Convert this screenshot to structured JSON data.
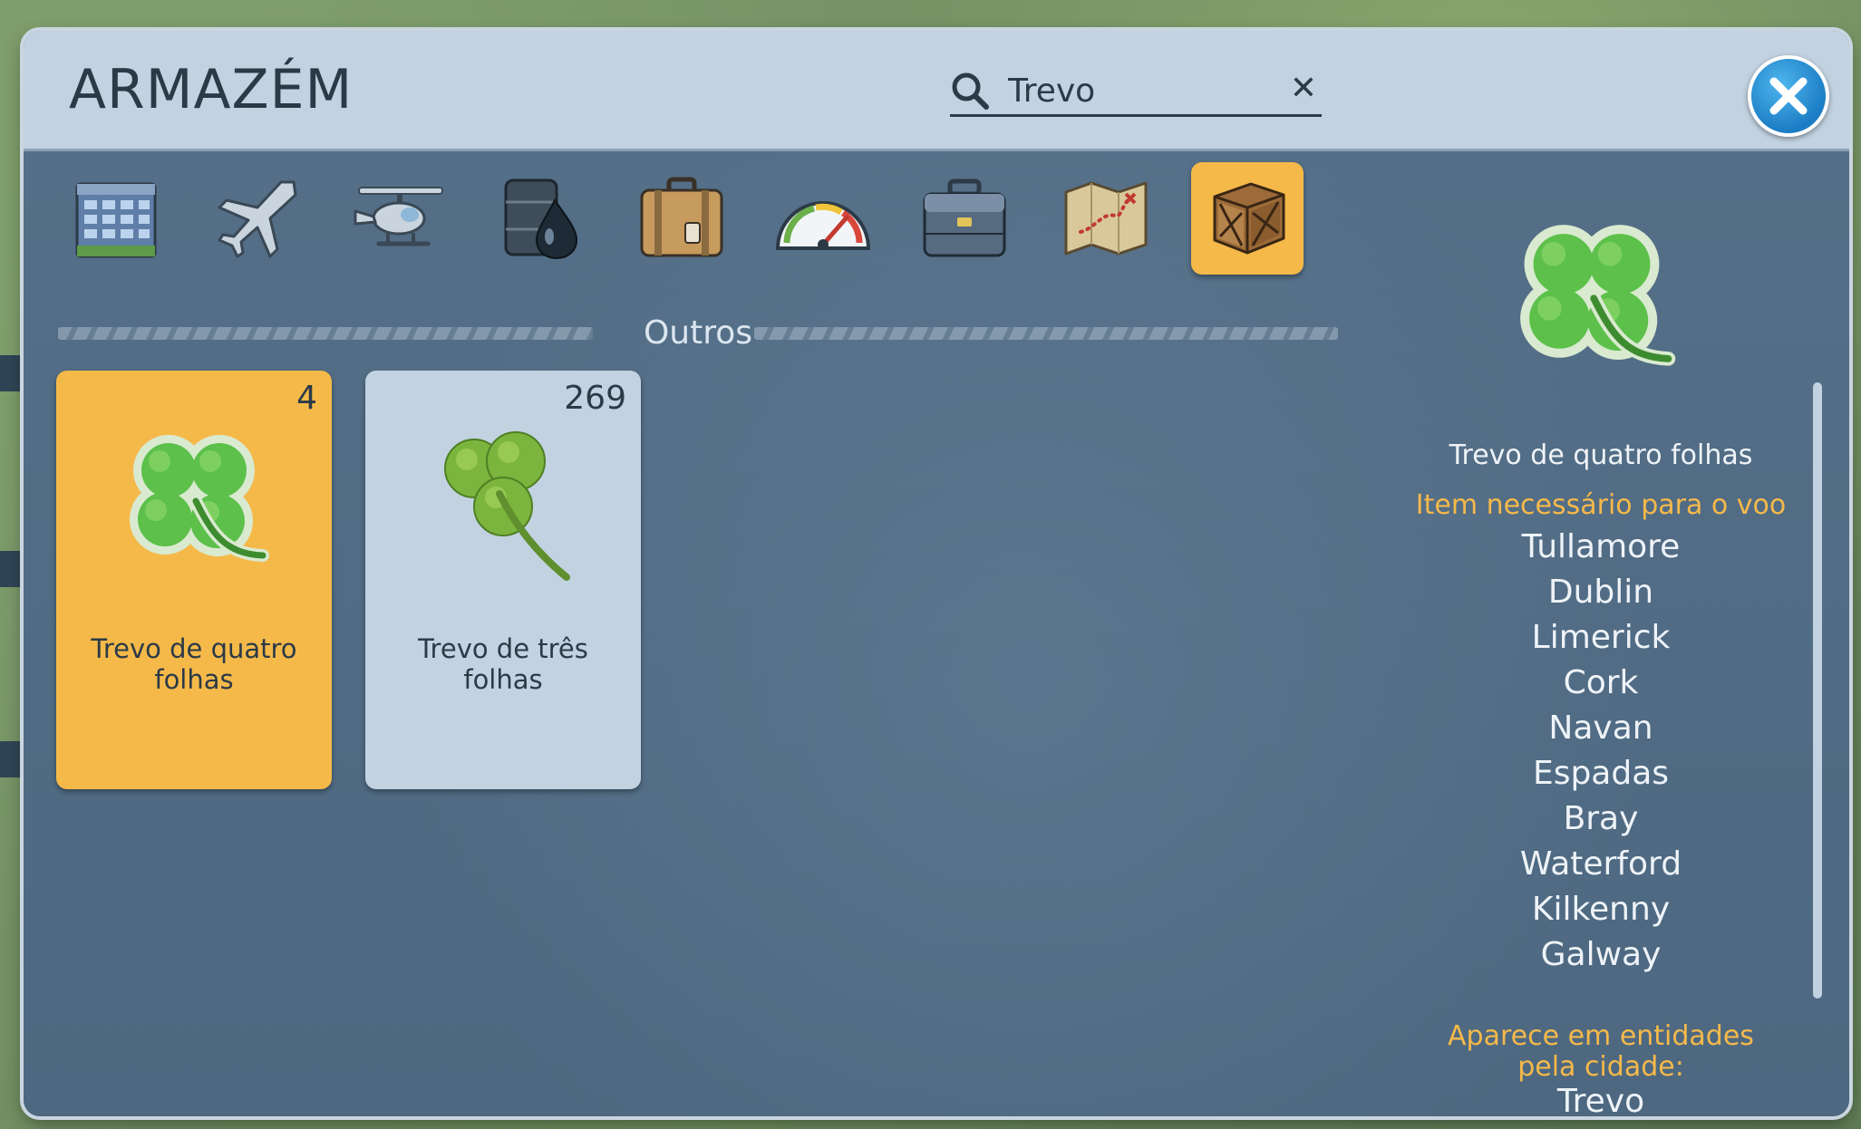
{
  "dialog": {
    "title": "ARMAZÉM",
    "search": {
      "value": "Trevo",
      "clear_label": "✕"
    },
    "close_icon": "close-icon"
  },
  "tabs": [
    {
      "name": "buildings",
      "icon": "building-icon"
    },
    {
      "name": "airplanes",
      "icon": "airplane-icon"
    },
    {
      "name": "helicopters",
      "icon": "helicopter-icon"
    },
    {
      "name": "fuel",
      "icon": "oil-barrel-icon"
    },
    {
      "name": "luggage",
      "icon": "suitcase-icon"
    },
    {
      "name": "speed",
      "icon": "speedometer-icon"
    },
    {
      "name": "tools",
      "icon": "toolbox-icon"
    },
    {
      "name": "maps",
      "icon": "map-icon"
    },
    {
      "name": "others",
      "icon": "crate-icon",
      "active": true
    }
  ],
  "section": {
    "label": "Outros"
  },
  "items": [
    {
      "count": "4",
      "name": "Trevo de quatro folhas",
      "icon": "four-leaf-clover-icon",
      "selected": true
    },
    {
      "count": "269",
      "name": "Trevo de três folhas",
      "icon": "three-leaf-clover-icon",
      "selected": false
    }
  ],
  "detail": {
    "icon": "four-leaf-clover-icon",
    "title": "Trevo de quatro folhas",
    "flights_heading": "Item necessário para o voo",
    "flights": [
      "Tullamore",
      "Dublin",
      "Limerick",
      "Cork",
      "Navan",
      "Espadas",
      "Bray",
      "Waterford",
      "Kilkenny",
      "Galway"
    ],
    "entities_heading": "Aparece em entidades pela cidade:",
    "entities": [
      "Trevo"
    ]
  },
  "colors": {
    "header": "#c2d2e1",
    "body": "#4f6a82",
    "accent": "#f5b94a",
    "close_button": "#1b7dc4"
  }
}
